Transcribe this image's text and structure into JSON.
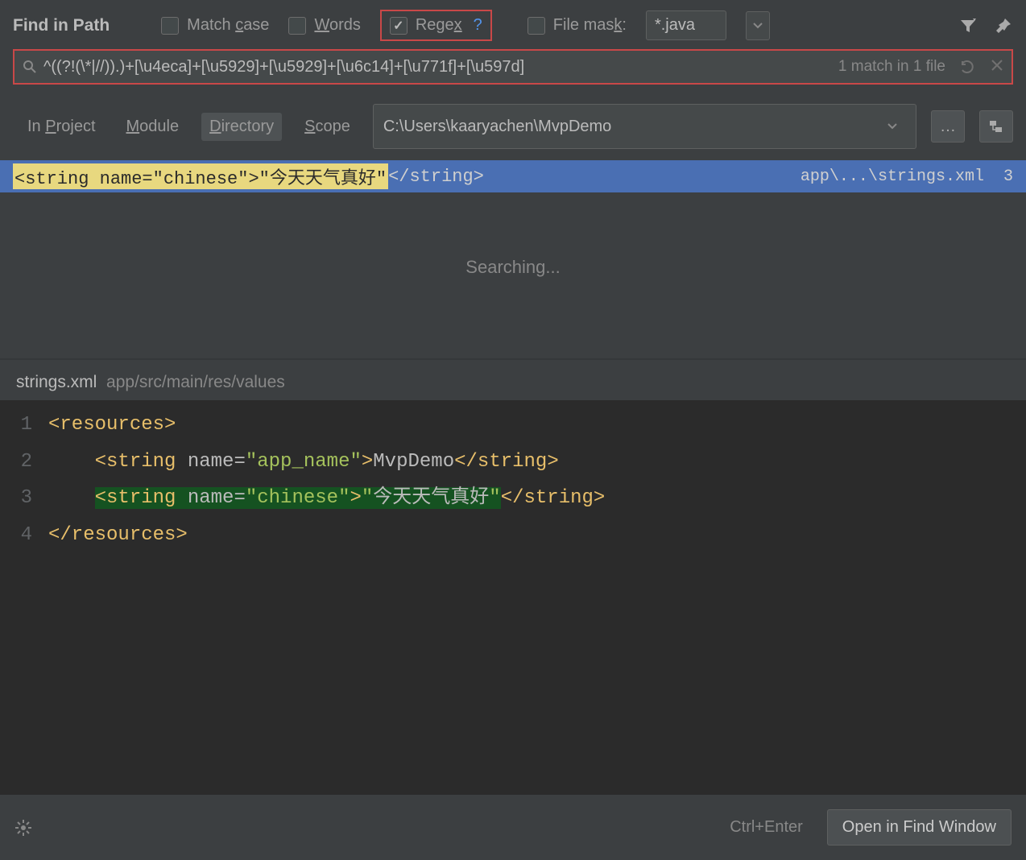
{
  "title": "Find in Path",
  "checkboxes": {
    "match_case": {
      "label_pre": "Match ",
      "letter": "c",
      "label_post": "ase",
      "checked": false
    },
    "words": {
      "label_pre": "",
      "letter": "W",
      "label_post": "ords",
      "checked": false
    },
    "regex": {
      "label_pre": "Rege",
      "letter": "x",
      "label_post": "",
      "checked": true
    },
    "file_mask": {
      "label_pre": "File mas",
      "letter": "k",
      "label_post": ":",
      "checked": false
    }
  },
  "file_mask_value": "*.java",
  "search": {
    "query": "^((?!(\\*|//)).)+[\\u4eca]+[\\u5929]+[\\u5929]+[\\u6c14]+[\\u771f]+[\\u597d]",
    "status": "1 match in 1 file"
  },
  "scope": {
    "in_project_pre": "In ",
    "in_project_letter": "P",
    "in_project_post": "roject",
    "module_letter": "M",
    "module_post": "odule",
    "directory_letter": "D",
    "directory_post": "irectory",
    "scope_letter": "S",
    "scope_post": "cope",
    "directory_path": "C:\\Users\\kaaryachen\\MvpDemo"
  },
  "result": {
    "highlighted": "<string name=\"chinese\">\"今天天气真好\"",
    "after": "</string>",
    "path": "app\\...\\strings.xml",
    "count": "3"
  },
  "searching_text": "Searching...",
  "preview": {
    "filename": "strings.xml",
    "filepath": "app/src/main/res/values",
    "lines": [
      {
        "n": "1",
        "html": "<span class='tag'>&lt;resources&gt;</span>"
      },
      {
        "n": "2",
        "html": "    <span class='tag'>&lt;string </span><span class='text-content'>name=</span><span class='attr-val'>\"app_name\"</span><span class='tag'>&gt;</span><span class='text-content'>MvpDemo</span><span class='tag'>&lt;/string&gt;</span>"
      },
      {
        "n": "3",
        "html": "    <span class='hl-green'><span class='tag'>&lt;string </span><span class='text-content'>name=</span><span class='attr-val'>\"chinese\"</span><span class='tag'>&gt;</span><span class='string'>\"</span><span class='text-content'>今天天气真好</span><span class='string'>\"</span></span><span class='tag'>&lt;/string&gt;</span>"
      },
      {
        "n": "4",
        "html": "<span class='tag'>&lt;/resources&gt;</span>"
      }
    ]
  },
  "footer": {
    "hint": "Ctrl+Enter",
    "button": "Open in Find Window"
  }
}
